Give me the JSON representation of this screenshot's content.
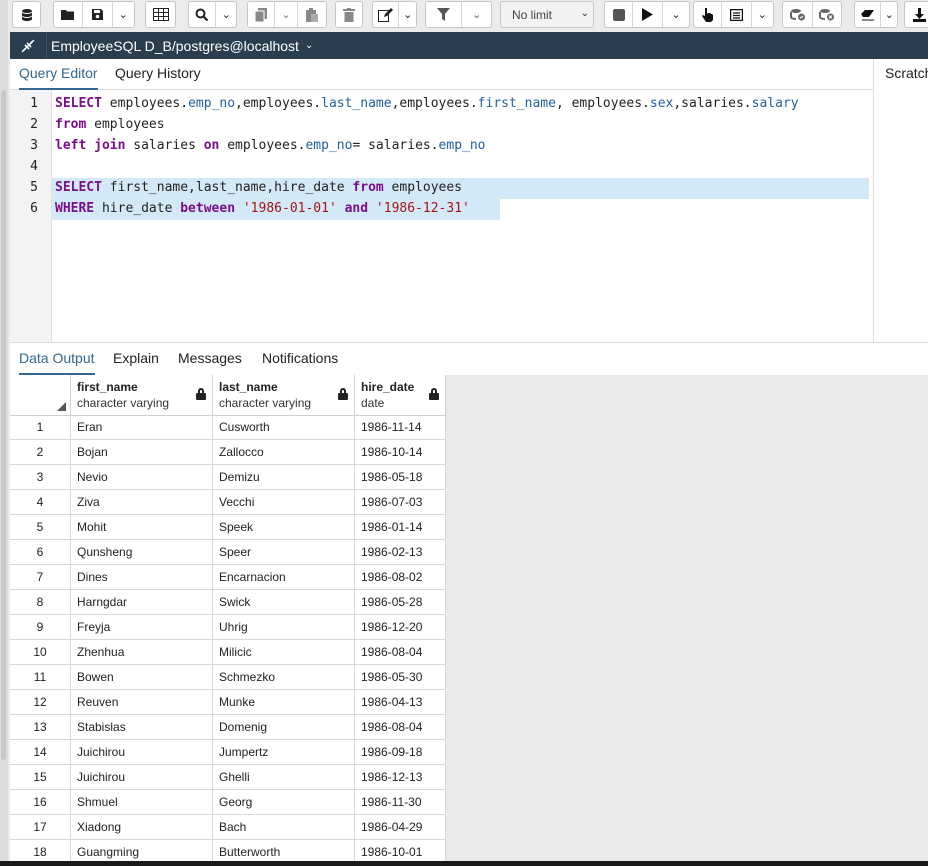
{
  "toolbar": {
    "limit_select": "No limit",
    "icons": [
      "database-icon",
      "open-file-icon",
      "save-icon",
      "save-dropdown-icon",
      "table-view-icon",
      "search-icon",
      "search-dropdown-icon",
      "copy-icon",
      "copy-dropdown-icon",
      "paste-icon",
      "delete-icon",
      "edit-icon",
      "filter-icon",
      "filter-dropdown-icon",
      "stop-icon",
      "execute-icon",
      "execute-dropdown-icon",
      "cursor-icon",
      "explain-icon",
      "explain-dropdown-icon",
      "commit-icon",
      "rollback-icon",
      "clear-icon",
      "download-icon"
    ]
  },
  "connection": {
    "title": "EmployeeSQL D_B/postgres@localhost"
  },
  "editor_tabs": [
    "Query Editor",
    "Query History"
  ],
  "scratch_label": "Scratch",
  "editor": {
    "line_numbers": [
      "1",
      "2",
      "3",
      "4",
      "5",
      "6"
    ],
    "highlighted_lines": [
      5,
      6
    ]
  },
  "output_tabs": [
    "Data Output",
    "Explain",
    "Messages",
    "Notifications"
  ],
  "grid": {
    "columns": [
      {
        "name": "first_name",
        "type": "character varying"
      },
      {
        "name": "last_name",
        "type": "character varying"
      },
      {
        "name": "hire_date",
        "type": "date"
      }
    ],
    "rows": [
      [
        "1",
        "Eran",
        "Cusworth",
        "1986-11-14"
      ],
      [
        "2",
        "Bojan",
        "Zallocco",
        "1986-10-14"
      ],
      [
        "3",
        "Nevio",
        "Demizu",
        "1986-05-18"
      ],
      [
        "4",
        "Ziva",
        "Vecchi",
        "1986-07-03"
      ],
      [
        "5",
        "Mohit",
        "Speek",
        "1986-01-14"
      ],
      [
        "6",
        "Qunsheng",
        "Speer",
        "1986-02-13"
      ],
      [
        "7",
        "Dines",
        "Encarnacion",
        "1986-08-02"
      ],
      [
        "8",
        "Harngdar",
        "Swick",
        "1986-05-28"
      ],
      [
        "9",
        "Freyja",
        "Uhrig",
        "1986-12-20"
      ],
      [
        "10",
        "Zhenhua",
        "Milicic",
        "1986-08-04"
      ],
      [
        "11",
        "Bowen",
        "Schmezko",
        "1986-05-30"
      ],
      [
        "12",
        "Reuven",
        "Munke",
        "1986-04-13"
      ],
      [
        "13",
        "Stabislas",
        "Domenig",
        "1986-08-04"
      ],
      [
        "14",
        "Juichirou",
        "Jumpertz",
        "1986-09-18"
      ],
      [
        "15",
        "Juichirou",
        "Ghelli",
        "1986-12-13"
      ],
      [
        "16",
        "Shmuel",
        "Georg",
        "1986-11-30"
      ],
      [
        "17",
        "Xiadong",
        "Bach",
        "1986-04-29"
      ],
      [
        "18",
        "Guangming",
        "Butterworth",
        "1986-10-01"
      ]
    ]
  },
  "colors": {
    "connection_bar": "#2b3e50",
    "active_tab": "#326690",
    "keyword": "#7a0f8a",
    "field": "#1f5f9e",
    "string": "#a31515",
    "selection": "#d4e9f8"
  }
}
